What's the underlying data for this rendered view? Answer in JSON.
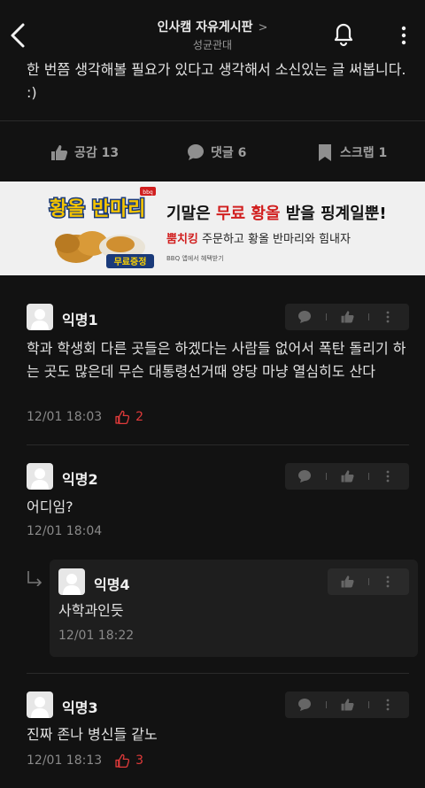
{
  "header": {
    "title": "인사캠 자유게시판",
    "title_chevron": ">",
    "subtitle": "성균관대",
    "icons": [
      "back-arrow-icon",
      "bell-icon",
      "more-vertical-icon"
    ]
  },
  "post": {
    "body": "한 번쯤 생각해볼 필요가 있다고 생각해서 소신있는 글 써봅니다. :)"
  },
  "actions": {
    "like_label": "공감 13",
    "comment_label": "댓글 6",
    "scrap_label": "스크랩 1"
  },
  "ad": {
    "img_title": "황올 반마리",
    "img_badge": "무료증정",
    "img_brand": "bbq",
    "headline_1": "기말은 ",
    "headline_red": "무료 황올",
    "headline_2": " 받을 핑계일뿐!",
    "sub_red": "뿜치킹",
    "sub_rest": " 주문하고 황올 반마리와 힘내자",
    "note": "BBQ 앱에서 혜택받기"
  },
  "comments": [
    {
      "name": "익명1",
      "body": "학과 학생회 다른 곳들은 하겠다는 사람들 없어서 폭탄 돌리기 하는 곳도 많은데 무슨 대통령선거때 양당 마냥 열심히도 산다",
      "time": "12/01 18:03",
      "likes": "2"
    },
    {
      "name": "익명2",
      "body": "어디임?",
      "time": "12/01 18:04"
    },
    {
      "name": "익명4",
      "body": "사학과인듯",
      "time": "12/01 18:22",
      "is_reply": true
    },
    {
      "name": "익명3",
      "body": "진짜 존나 병신들 같노",
      "time": "12/01 18:13",
      "likes": "3"
    }
  ],
  "colors": {
    "background": "#121212",
    "accent_red": "#e03a3a",
    "muted": "#8a8a8a"
  }
}
